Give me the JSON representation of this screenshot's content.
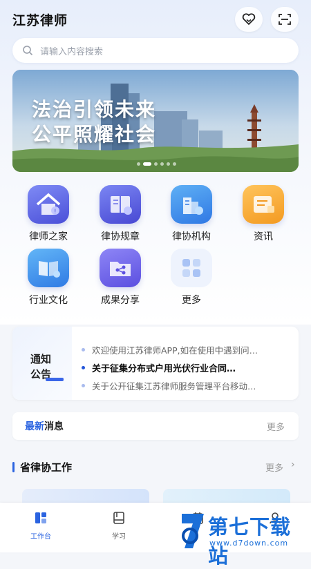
{
  "header": {
    "title": "江苏律师"
  },
  "search": {
    "placeholder": "请输入内容搜索"
  },
  "banner": {
    "line1": "法治引领未来",
    "line2": "公平照耀社会"
  },
  "grid": [
    {
      "label": "律师之家",
      "icon": "lawyer-home-icon"
    },
    {
      "label": "律协规章",
      "icon": "regulations-book-icon"
    },
    {
      "label": "律协机构",
      "icon": "organization-building-icon"
    },
    {
      "label": "资讯",
      "icon": "news-icon"
    },
    {
      "label": "行业文化",
      "icon": "culture-book-icon"
    },
    {
      "label": "成果分享",
      "icon": "share-folder-icon"
    },
    {
      "label": "更多",
      "icon": "more-grid-icon"
    }
  ],
  "notice": {
    "tag_line1": "通知",
    "tag_line2": "公告",
    "items": [
      "欢迎使用江苏律师APP,如在使用中遇到问…",
      "关于征集分布式户用光伏行业合同…",
      "关于公开征集江苏律师服务管理平台移动…"
    ]
  },
  "news": {
    "label_a": "最新",
    "label_b": "消息",
    "more": "更多"
  },
  "section": {
    "title": "省律协工作",
    "more": "更多"
  },
  "tabbar": [
    {
      "label": "工作台",
      "icon": "workbench-icon",
      "active": true
    },
    {
      "label": "学习",
      "icon": "study-book-icon",
      "active": false
    },
    {
      "label": "",
      "icon": "calendar-icon",
      "active": false
    },
    {
      "label": "",
      "icon": "user-icon",
      "active": false
    }
  ],
  "watermark": {
    "text": "第七下载站",
    "url": "www.d7down.com"
  },
  "colors": {
    "accent": "#2a63e0",
    "watermark": "#1b6fd8"
  }
}
